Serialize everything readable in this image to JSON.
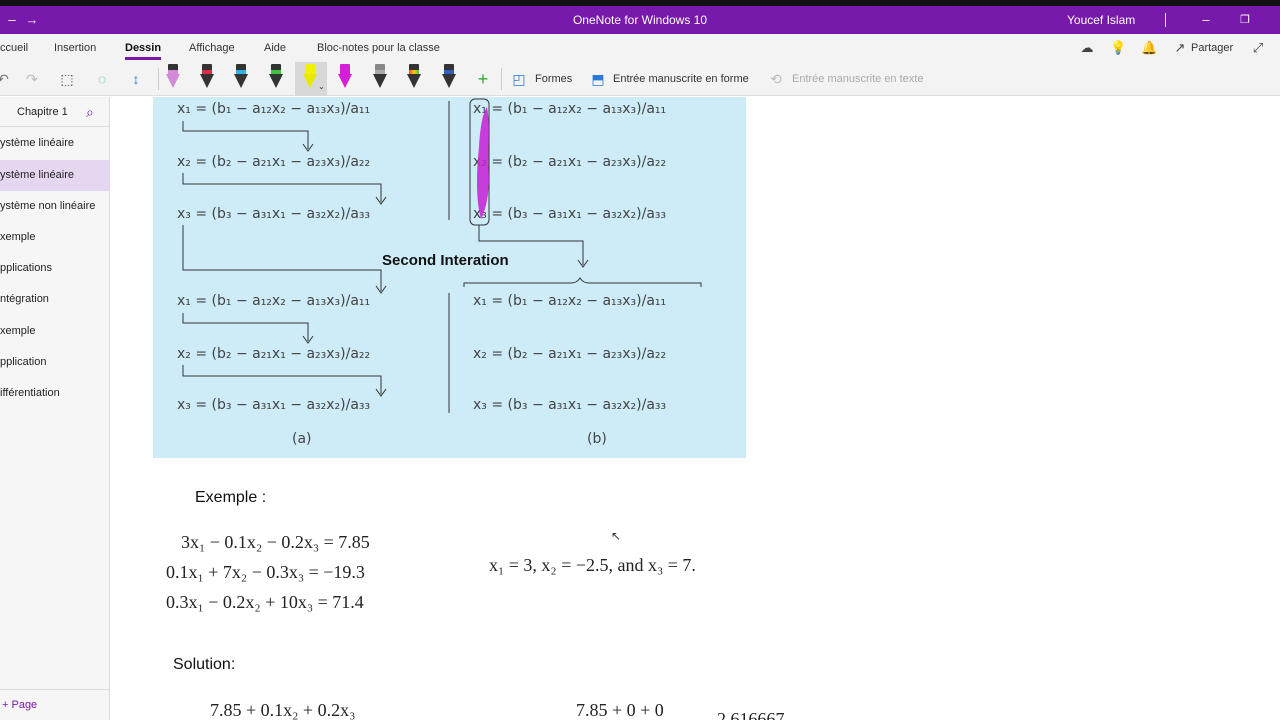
{
  "window": {
    "title": "OneNote for Windows 10",
    "user": "Youcef Islam"
  },
  "menu": {
    "tabs": [
      "ccueil",
      "Insertion",
      "Dessin",
      "Affichage",
      "Aide",
      "Bloc-notes pour la classe"
    ],
    "active": "Dessin",
    "share": "Partager"
  },
  "toolbar": {
    "shapes": "Formes",
    "ink_to_shape": "Entrée manuscrite en forme",
    "ink_to_text": "Entrée manuscrite en texte"
  },
  "sidebar": {
    "section": "Chapitre 1",
    "pages": [
      "ystème linéaire",
      "ystème linéaire",
      "ystème non linéaire",
      "xemple",
      "pplications",
      "ntégration",
      "xemple",
      "pplication",
      "ifférentiation"
    ],
    "selected_index": 1,
    "add_page": "Page"
  },
  "figure": {
    "left_eqs": [
      "x₁ = (b₁ − a₁₂x₂ − a₁₃x₃)/a₁₁",
      "x₂ = (b₂ − a₂₁x₁ − a₂₃x₃)/a₂₂",
      "x₃ = (b₃ − a₃₁x₁ − a₃₂x₂)/a₃₃",
      "x₁ = (b₁ − a₁₂x₂ − a₁₃x₃)/a₁₁",
      "x₂ = (b₂ − a₂₁x₁ − a₂₃x₃)/a₂₂",
      "x₃ = (b₃ − a₃₁x₁ − a₃₂x₂)/a₃₃"
    ],
    "right_eqs": [
      "x₁ = (b₁ − a₁₂x₂ − a₁₃x₃)/a₁₁",
      "x₂ = (b₂ − a₂₁x₁ − a₂₃x₃)/a₂₂",
      "x₃ = (b₃ − a₃₁x₁ − a₃₂x₂)/a₃₃",
      "x₁ = (b₁ − a₁₂x₂ − a₁₃x₃)/a₁₁",
      "x₂ = (b₂ − a₂₁x₁ − a₂₃x₃)/a₂₂",
      "x₃ = (b₃ − a₃₁x₁ − a₃₂x₂)/a₃₃"
    ],
    "second_iteration": "Second Interation",
    "label_a": "(a)",
    "label_b": "(b)"
  },
  "example": {
    "heading": "Exemple :",
    "eq1": "3x₁ − 0.1x₂ − 0.2x₃ =    7.85",
    "eq2": "0.1x₁ +    7x₂ − 0.3x₃ = −19.3",
    "eq3": "0.3x₁ − 0.2x₂ + 10x₃ =    71.4",
    "solution_values": "x₁ = 3, x₂ = −2.5, and x₃ = 7."
  },
  "solution": {
    "heading": "Solution:",
    "partial_left": "7.85 + 0.1x₂ + 0.2x₃",
    "partial_right": "7.85 + 0 + 0",
    "partial_cut": "2.616667"
  },
  "colors": {
    "accent": "#7719aa",
    "figure_bg": "#cdecf8",
    "highlighter": "#c61fd6"
  }
}
